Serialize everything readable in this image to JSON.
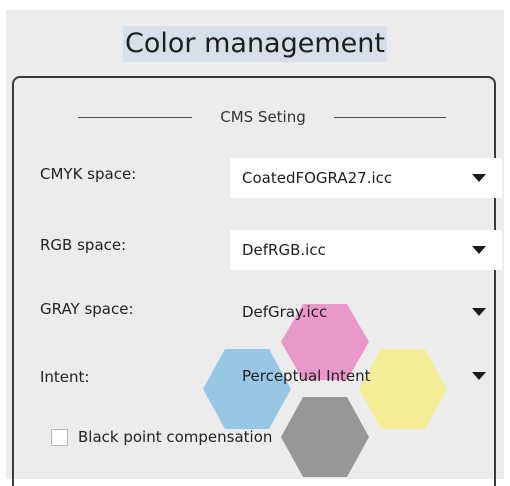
{
  "dialog": {
    "title": "Color management"
  },
  "cms_group": {
    "legend": "CMS Seting",
    "rows": [
      {
        "label": "CMYK space:",
        "value": "CoatedFOGRA27.icc"
      },
      {
        "label": "RGB space:",
        "value": "DefRGB.icc"
      },
      {
        "label": "GRAY space:",
        "value": "DefGray.icc"
      },
      {
        "label": "Intent:",
        "value": "Perceptual Intent"
      }
    ],
    "black_point": {
      "label": "Black point compensation",
      "checked": false
    }
  },
  "colors": {
    "panel_bg": "#ececec",
    "title_highlight": "#d7e0ea",
    "hex_cyan": "#8fc3e4",
    "hex_magenta": "#ea8fc4",
    "hex_yellow": "#f4ee8c",
    "hex_gray": "#8e8e8e"
  }
}
